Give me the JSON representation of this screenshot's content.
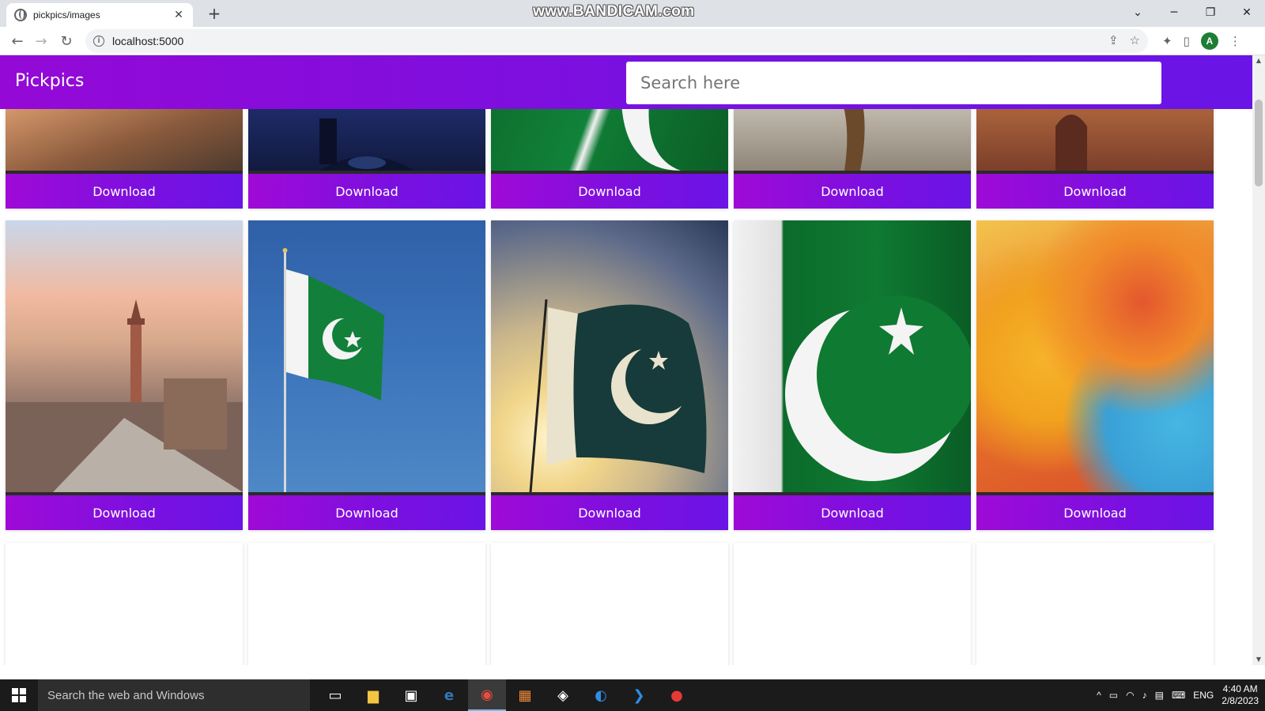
{
  "browser": {
    "tab_title": "pickpics/images",
    "tab_close": "✕",
    "new_tab": "+",
    "url": "localhost:5000",
    "watermark": "www.BANDICAM.com"
  },
  "app": {
    "brand": "Pickpics",
    "search_placeholder": "Search here"
  },
  "cards_row1": [
    {
      "button_label": "Download",
      "image": "mosque-courtyard"
    },
    {
      "button_label": "Download",
      "image": "boat-on-lake"
    },
    {
      "button_label": "Download",
      "image": "pakistan-flag-closeup"
    },
    {
      "button_label": "Download",
      "image": "camel"
    },
    {
      "button_label": "Download",
      "image": "fort-wall"
    }
  ],
  "cards_row2": [
    {
      "button_label": "Download",
      "image": "city-minaret"
    },
    {
      "button_label": "Download",
      "image": "pakistan-flag-pole"
    },
    {
      "button_label": "Download",
      "image": "pakistan-flag-sunset"
    },
    {
      "button_label": "Download",
      "image": "pakistan-flag-full"
    },
    {
      "button_label": "Download",
      "image": "map"
    }
  ],
  "taskbar": {
    "search_text": "Search the web and Windows",
    "language": "ENG",
    "time": "4:40 AM",
    "date": "2/8/2023"
  },
  "colors": {
    "header_gradient_start": "#9409d6",
    "header_gradient_end": "#6a14e6",
    "taskbar": "#1b1b1b"
  }
}
